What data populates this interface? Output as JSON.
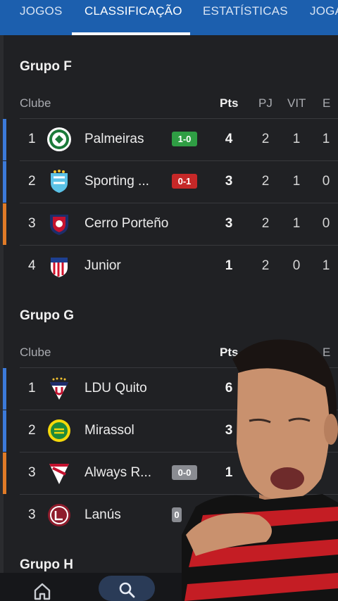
{
  "tabs": [
    {
      "label": "JOGOS"
    },
    {
      "label": "CLASSIFICAÇÃO"
    },
    {
      "label": "ESTATÍSTICAS"
    },
    {
      "label": "JOGA"
    }
  ],
  "groups": [
    {
      "title": "Grupo F",
      "headers": {
        "club": "Clube",
        "pts": "Pts",
        "pj": "PJ",
        "vit": "VIT",
        "e": "E"
      },
      "rows": [
        {
          "pos": "1",
          "team": "Palmeiras",
          "result": "1-0",
          "pts": "4",
          "pj": "2",
          "vit": "1",
          "e": "1"
        },
        {
          "pos": "2",
          "team": "Sporting ...",
          "result": "0-1",
          "pts": "3",
          "pj": "2",
          "vit": "1",
          "e": "0"
        },
        {
          "pos": "3",
          "team": "Cerro Porteño",
          "result": "",
          "pts": "3",
          "pj": "2",
          "vit": "1",
          "e": "0"
        },
        {
          "pos": "4",
          "team": "Junior",
          "result": "",
          "pts": "1",
          "pj": "2",
          "vit": "0",
          "e": "1"
        }
      ]
    },
    {
      "title": "Grupo G",
      "headers": {
        "club": "Clube",
        "pts": "Pts",
        "e": "E"
      },
      "rows": [
        {
          "pos": "1",
          "team": "LDU Quito",
          "result": "",
          "pts": "6"
        },
        {
          "pos": "2",
          "team": "Mirassol",
          "result": "",
          "pts": "3"
        },
        {
          "pos": "3",
          "team": "Always R...",
          "result": "0-0",
          "pts": "1"
        },
        {
          "pos": "3",
          "team": "Lanús",
          "result": "0",
          "pts": ""
        }
      ]
    },
    {
      "title": "Grupo H"
    }
  ],
  "colors": {
    "tab_bar": "#1c5fae",
    "win": "#2f9e44",
    "loss": "#c62828",
    "draw": "#8a8c92",
    "qualify_bar": "#3c7ad9",
    "playoff_bar": "#e07b27"
  },
  "nav": {
    "home_icon": "home-icon",
    "search_icon": "search-icon"
  }
}
